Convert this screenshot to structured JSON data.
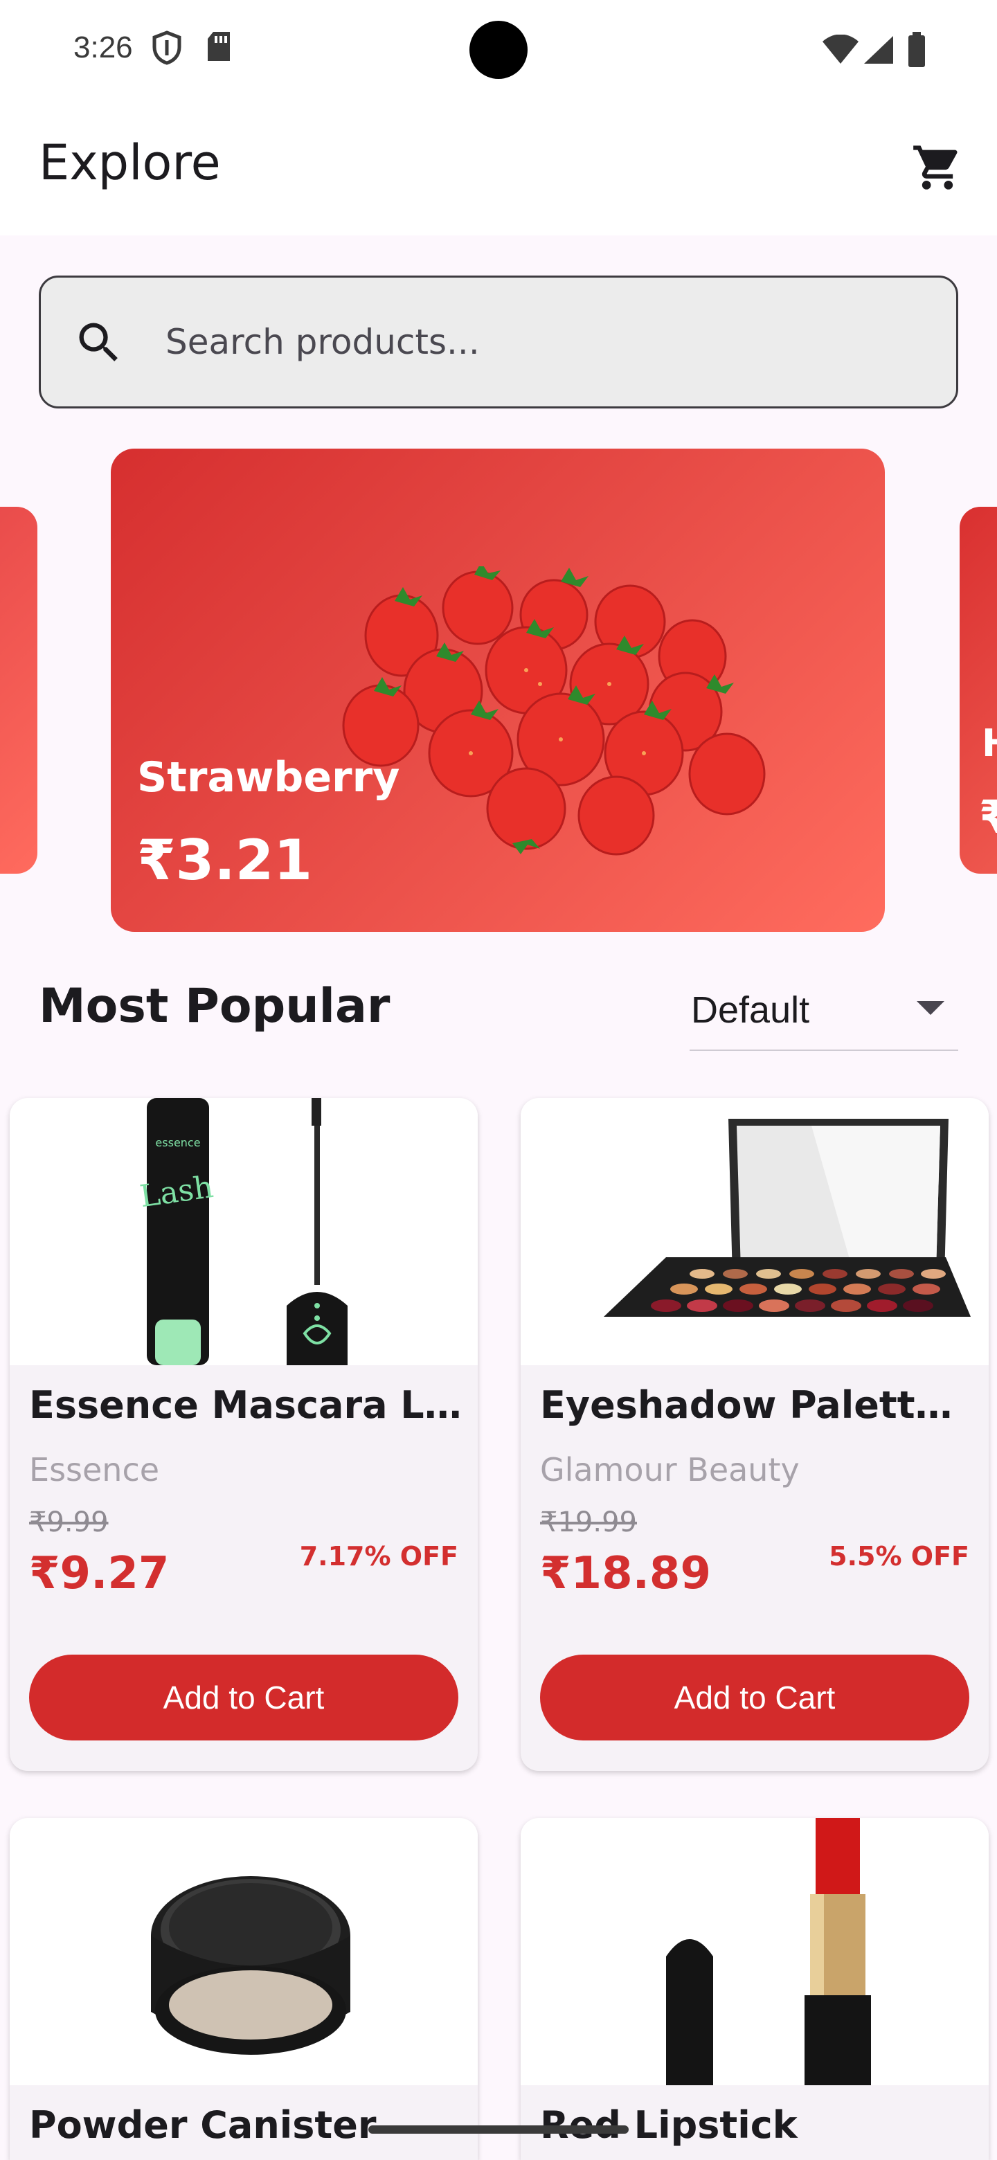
{
  "status_bar": {
    "time": "3:26"
  },
  "app_bar": {
    "title": "Explore"
  },
  "search": {
    "placeholder": "Search products..."
  },
  "banner": {
    "name": "Strawberry",
    "price": "₹3.21",
    "next_peek_initial": "H",
    "next_peek_price": "₹"
  },
  "section": {
    "title": "Most Popular",
    "sort_selected": "Default"
  },
  "products": [
    {
      "name": "Essence Mascara Lash Princess",
      "brand": "Essence",
      "old_price": "₹9.99",
      "price": "₹9.27",
      "discount": "7.17% OFF",
      "button": "Add to Cart"
    },
    {
      "name": "Eyeshadow Palette with Mirror",
      "brand": "Glamour Beauty",
      "old_price": "₹19.99",
      "price": "₹18.89",
      "discount": "5.5% OFF",
      "button": "Add to Cart"
    },
    {
      "name": "Powder Canister"
    },
    {
      "name": "Red Lipstick"
    }
  ],
  "colors": {
    "accent": "#d32f2f",
    "banner_start": "#d62f2f",
    "banner_end": "#ff6c5e",
    "background": "#fdf7fd"
  }
}
